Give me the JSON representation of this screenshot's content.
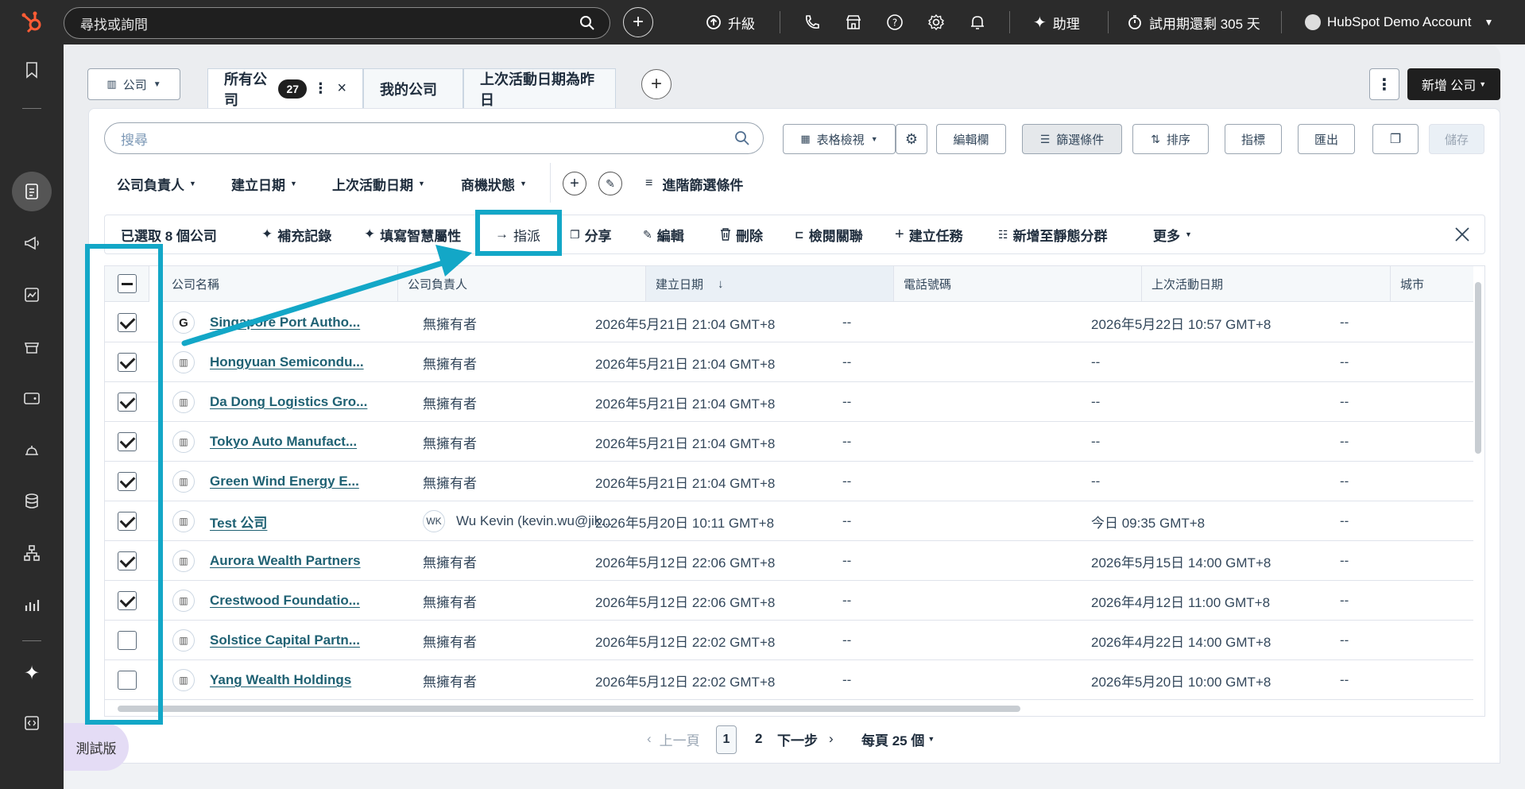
{
  "topbar": {
    "search_placeholder": "尋找或詢問",
    "upgrade_label": "升級",
    "assistant_label": "助理",
    "trial_label": "試用期還剩 305 天",
    "account_label": "HubSpot Demo Account"
  },
  "header": {
    "object_selector": "公司",
    "tabs": [
      {
        "label": "所有公司",
        "count": "27"
      },
      {
        "label": "我的公司"
      },
      {
        "label": "上次活動日期為昨日"
      }
    ],
    "new_button": "新增 公司"
  },
  "toolbar": {
    "search_placeholder": "搜尋",
    "table_view": "表格檢視",
    "edit_columns": "編輯欄",
    "filters": "篩選條件",
    "sort": "排序",
    "metrics": "指標",
    "export": "匯出",
    "save": "儲存"
  },
  "filters": {
    "owner": "公司負責人",
    "created": "建立日期",
    "last_activity": "上次活動日期",
    "deal_status": "商機狀態",
    "advanced": "進階篩選條件"
  },
  "bulk": {
    "selected": "已選取 8 個公司",
    "enrich": "補充記錄",
    "smart_props": "填寫智慧屬性",
    "assign": "指派",
    "share": "分享",
    "edit": "編輯",
    "delete": "刪除",
    "view_assoc": "檢閱關聯",
    "create_task": "建立任務",
    "add_static": "新增至靜態分群",
    "more": "更多"
  },
  "table": {
    "columns": [
      "公司名稱",
      "公司負責人",
      "建立日期",
      "電話號碼",
      "上次活動日期",
      "城市"
    ],
    "rows": [
      {
        "name": "Singapore Port Autho...",
        "owner": "無擁有者",
        "created": "2026年5月21日 21:04 GMT+8",
        "phone": "--",
        "last": "2026年5月22日 10:57 GMT+8",
        "city": "--",
        "checked": true,
        "icon": "G"
      },
      {
        "name": "Hongyuan Semicondu...",
        "owner": "無擁有者",
        "created": "2026年5月21日 21:04 GMT+8",
        "phone": "--",
        "last": "--",
        "city": "--",
        "checked": true
      },
      {
        "name": "Da Dong Logistics Gro...",
        "owner": "無擁有者",
        "created": "2026年5月21日 21:04 GMT+8",
        "phone": "--",
        "last": "--",
        "city": "--",
        "checked": true
      },
      {
        "name": "Tokyo Auto Manufact...",
        "owner": "無擁有者",
        "created": "2026年5月21日 21:04 GMT+8",
        "phone": "--",
        "last": "--",
        "city": "--",
        "checked": true
      },
      {
        "name": "Green Wind Energy E...",
        "owner": "無擁有者",
        "created": "2026年5月21日 21:04 GMT+8",
        "phone": "--",
        "last": "--",
        "city": "--",
        "checked": true
      },
      {
        "name": "Test 公司",
        "owner": "Wu Kevin (kevin.wu@jik...",
        "owner_initials": "WK",
        "created": "2026年5月20日 10:11 GMT+8",
        "phone": "--",
        "last": "今日 09:35 GMT+8",
        "city": "--",
        "checked": true
      },
      {
        "name": "Aurora Wealth Partners",
        "owner": "無擁有者",
        "created": "2026年5月12日 22:06 GMT+8",
        "phone": "--",
        "last": "2026年5月15日 14:00 GMT+8",
        "city": "--",
        "checked": true
      },
      {
        "name": "Crestwood Foundatio...",
        "owner": "無擁有者",
        "created": "2026年5月12日 22:06 GMT+8",
        "phone": "--",
        "last": "2026年4月12日 11:00 GMT+8",
        "city": "--",
        "checked": true
      },
      {
        "name": "Solstice Capital Partn...",
        "owner": "無擁有者",
        "created": "2026年5月12日 22:02 GMT+8",
        "phone": "--",
        "last": "2026年4月22日 14:00 GMT+8",
        "city": "--",
        "checked": false
      },
      {
        "name": "Yang Wealth Holdings",
        "owner": "無擁有者",
        "created": "2026年5月12日 22:02 GMT+8",
        "phone": "--",
        "last": "2026年5月20日 10:00 GMT+8",
        "city": "--",
        "checked": false
      }
    ]
  },
  "pagination": {
    "prev": "上一頁",
    "current": "1",
    "page2": "2",
    "next": "下一步",
    "per_page": "每頁 25 個"
  },
  "beta_label": "測試版",
  "colors": {
    "highlight": "#13a7c7",
    "link": "#1f6173",
    "dark": "#2b2b2b"
  }
}
